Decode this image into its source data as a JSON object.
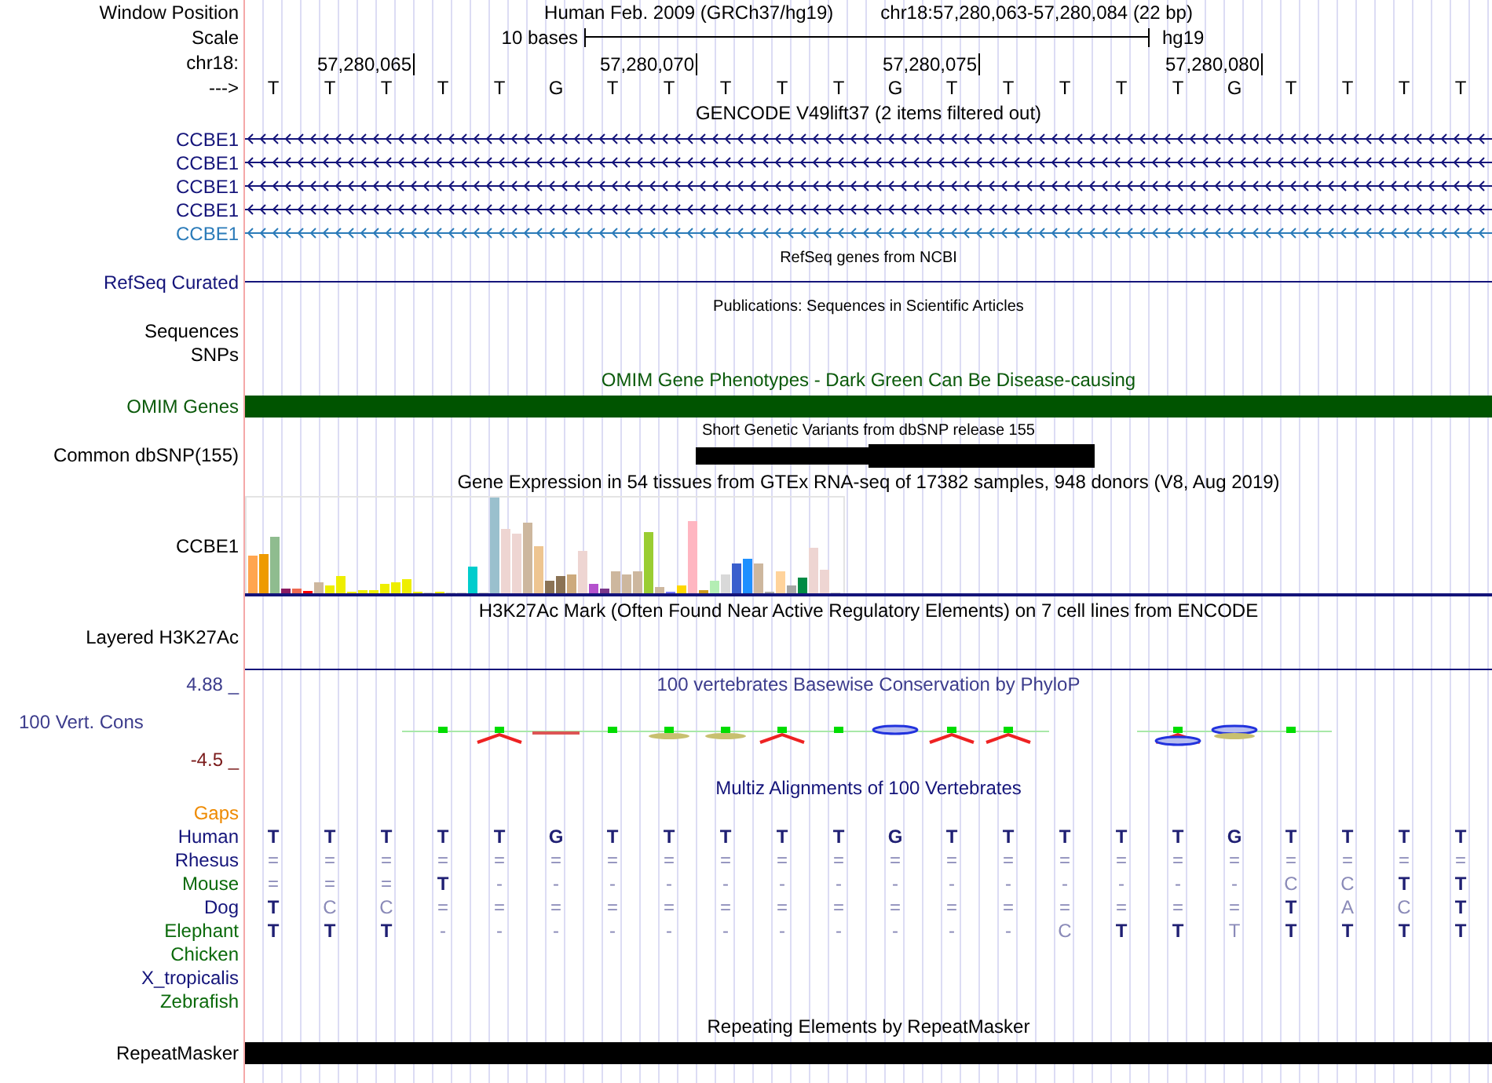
{
  "header": {
    "window_label": "Window Position",
    "assembly": "Human Feb. 2009 (GRCh37/hg19)",
    "position": "chr18:57,280,063-57,280,084 (22 bp)",
    "scale_label": "Scale",
    "scale_text": "10 bases",
    "scale_db": "hg19",
    "chrom_label": "chr18:",
    "ticks": [
      "57,280,065",
      "57,280,070",
      "57,280,075",
      "57,280,080"
    ],
    "strand_label": "--->",
    "bases": [
      "T",
      "T",
      "T",
      "T",
      "T",
      "G",
      "T",
      "T",
      "T",
      "T",
      "T",
      "G",
      "T",
      "T",
      "T",
      "T",
      "T",
      "G",
      "T",
      "T",
      "T",
      "T"
    ]
  },
  "tracks": [
    {
      "kind": "genes",
      "title": {
        "text": "GENCODE V49lift37 (2 items filtered out)",
        "color": "#000000"
      },
      "items": [
        {
          "label": "CCBE1",
          "color": "#14147a"
        },
        {
          "label": "CCBE1",
          "color": "#14147a"
        },
        {
          "label": "CCBE1",
          "color": "#14147a"
        },
        {
          "label": "CCBE1",
          "color": "#14147a"
        },
        {
          "label": "CCBE1",
          "color": "#2b7bb9"
        }
      ]
    },
    {
      "kind": "line",
      "title": {
        "text": "RefSeq genes from NCBI",
        "color": "#000000"
      },
      "label": {
        "text": "RefSeq Curated",
        "color": "#14147a"
      }
    },
    {
      "kind": "labels",
      "title": {
        "text": "Publications: Sequences in Scientific Articles",
        "color": "#000000"
      },
      "labels": [
        "Sequences",
        "SNPs"
      ]
    },
    {
      "kind": "bar",
      "title": {
        "text": "OMIM Gene Phenotypes - Dark Green Can Be Disease-causing",
        "color": "#0b5a0b"
      },
      "label": {
        "text": "OMIM Genes",
        "color": "#0b5a0b"
      },
      "bar": {
        "color": "#005400"
      }
    },
    {
      "kind": "snp",
      "title": {
        "text": "Short Genetic Variants from dbSNP release 155",
        "color": "#000000"
      },
      "label": {
        "text": "Common dbSNP(155)",
        "color": "#000000"
      }
    },
    {
      "kind": "expression",
      "title": {
        "text": "Gene Expression in 54 tissues from GTEx RNA-seq of 17382 samples, 948 donors (V8, Aug 2019)",
        "color": "#000000"
      },
      "label": {
        "text": "CCBE1",
        "color": "#000000"
      }
    },
    {
      "kind": "blank",
      "title": {
        "text": "H3K27Ac Mark (Often Found Near Active Regulatory Elements) on 7 cell lines from ENCODE",
        "color": "#000000"
      },
      "label": {
        "text": "Layered H3K27Ac",
        "color": "#000000"
      }
    },
    {
      "kind": "wiggle",
      "title": {
        "text": "100 vertebrates Basewise Conservation by PhyloP",
        "color": "#3c3c8c"
      },
      "label": {
        "text": "100 Vert. Cons",
        "color": "#3c3c8c"
      },
      "max": {
        "text": "4.88 _",
        "color": "#3c3c8c"
      },
      "min": {
        "text": "-4.5 _",
        "color": "#7a1a1a"
      }
    },
    {
      "kind": "alignment",
      "title": {
        "text": "Multiz Alignments of 100 Vertebrates",
        "color": "#14147a"
      },
      "gaps": {
        "text": "Gaps",
        "color": "#ee8a00"
      },
      "rows": [
        {
          "species": "Human",
          "color": "#14147a",
          "cells": [
            {
              "base": "T",
              "faint": false
            },
            {
              "base": "T",
              "faint": false
            },
            {
              "base": "T",
              "faint": false
            },
            {
              "base": "T",
              "faint": false
            },
            {
              "base": "T",
              "faint": false
            },
            {
              "base": "G",
              "faint": false
            },
            {
              "base": "T",
              "faint": false
            },
            {
              "base": "T",
              "faint": false
            },
            {
              "base": "T",
              "faint": false
            },
            {
              "base": "T",
              "faint": false
            },
            {
              "base": "T",
              "faint": false
            },
            {
              "base": "G",
              "faint": false
            },
            {
              "base": "T",
              "faint": false
            },
            {
              "base": "T",
              "faint": false
            },
            {
              "base": "T",
              "faint": false
            },
            {
              "base": "T",
              "faint": false
            },
            {
              "base": "T",
              "faint": false
            },
            {
              "base": "G",
              "faint": false
            },
            {
              "base": "T",
              "faint": false
            },
            {
              "base": "T",
              "faint": false
            },
            {
              "base": "T",
              "faint": false
            },
            {
              "base": "T",
              "faint": false
            }
          ]
        },
        {
          "species": "Rhesus",
          "color": "#14147a",
          "cells": [
            {
              "base": "=",
              "faint": true
            },
            {
              "base": "=",
              "faint": true
            },
            {
              "base": "=",
              "faint": true
            },
            {
              "base": "=",
              "faint": true
            },
            {
              "base": "=",
              "faint": true
            },
            {
              "base": "=",
              "faint": true
            },
            {
              "base": "=",
              "faint": true
            },
            {
              "base": "=",
              "faint": true
            },
            {
              "base": "=",
              "faint": true
            },
            {
              "base": "=",
              "faint": true
            },
            {
              "base": "=",
              "faint": true
            },
            {
              "base": "=",
              "faint": true
            },
            {
              "base": "=",
              "faint": true
            },
            {
              "base": "=",
              "faint": true
            },
            {
              "base": "=",
              "faint": true
            },
            {
              "base": "=",
              "faint": true
            },
            {
              "base": "=",
              "faint": true
            },
            {
              "base": "=",
              "faint": true
            },
            {
              "base": "=",
              "faint": true
            },
            {
              "base": "=",
              "faint": true
            },
            {
              "base": "=",
              "faint": true
            },
            {
              "base": "=",
              "faint": true
            }
          ]
        },
        {
          "species": "Mouse",
          "color": "#0b6a0b",
          "cells": [
            {
              "base": "=",
              "faint": true
            },
            {
              "base": "=",
              "faint": true
            },
            {
              "base": "=",
              "faint": true
            },
            {
              "base": "T",
              "faint": false
            },
            {
              "base": "-",
              "faint": true
            },
            {
              "base": "-",
              "faint": true
            },
            {
              "base": "-",
              "faint": true
            },
            {
              "base": "-",
              "faint": true
            },
            {
              "base": "-",
              "faint": true
            },
            {
              "base": "-",
              "faint": true
            },
            {
              "base": "-",
              "faint": true
            },
            {
              "base": "-",
              "faint": true
            },
            {
              "base": "-",
              "faint": true
            },
            {
              "base": "-",
              "faint": true
            },
            {
              "base": "-",
              "faint": true
            },
            {
              "base": "-",
              "faint": true
            },
            {
              "base": "-",
              "faint": true
            },
            {
              "base": "-",
              "faint": true
            },
            {
              "base": "C",
              "faint": true
            },
            {
              "base": "C",
              "faint": true
            },
            {
              "base": "T",
              "faint": false
            },
            {
              "base": "T",
              "faint": false
            }
          ]
        },
        {
          "species": "Dog",
          "color": "#14147a",
          "cells": [
            {
              "base": "T",
              "faint": false
            },
            {
              "base": "C",
              "faint": true
            },
            {
              "base": "C",
              "faint": true
            },
            {
              "base": "=",
              "faint": true
            },
            {
              "base": "=",
              "faint": true
            },
            {
              "base": "=",
              "faint": true
            },
            {
              "base": "=",
              "faint": true
            },
            {
              "base": "=",
              "faint": true
            },
            {
              "base": "=",
              "faint": true
            },
            {
              "base": "=",
              "faint": true
            },
            {
              "base": "=",
              "faint": true
            },
            {
              "base": "=",
              "faint": true
            },
            {
              "base": "=",
              "faint": true
            },
            {
              "base": "=",
              "faint": true
            },
            {
              "base": "=",
              "faint": true
            },
            {
              "base": "=",
              "faint": true
            },
            {
              "base": "=",
              "faint": true
            },
            {
              "base": "=",
              "faint": true
            },
            {
              "base": "T",
              "faint": false
            },
            {
              "base": "A",
              "faint": true
            },
            {
              "base": "C",
              "faint": true
            },
            {
              "base": "T",
              "faint": false
            }
          ]
        },
        {
          "species": "Elephant",
          "color": "#0b6a0b",
          "cells": [
            {
              "base": "T",
              "faint": false
            },
            {
              "base": "T",
              "faint": false
            },
            {
              "base": "T",
              "faint": false
            },
            {
              "base": "-",
              "faint": true
            },
            {
              "base": "-",
              "faint": true
            },
            {
              "base": "-",
              "faint": true
            },
            {
              "base": "-",
              "faint": true
            },
            {
              "base": "-",
              "faint": true
            },
            {
              "base": "-",
              "faint": true
            },
            {
              "base": "-",
              "faint": true
            },
            {
              "base": "-",
              "faint": true
            },
            {
              "base": "-",
              "faint": true
            },
            {
              "base": "-",
              "faint": true
            },
            {
              "base": "-",
              "faint": true
            },
            {
              "base": "C",
              "faint": true
            },
            {
              "base": "T",
              "faint": false
            },
            {
              "base": "T",
              "faint": false
            },
            {
              "base": "T",
              "faint": true
            },
            {
              "base": "T",
              "faint": false
            },
            {
              "base": "T",
              "faint": false
            },
            {
              "base": "T",
              "faint": false
            },
            {
              "base": "T",
              "faint": false
            }
          ]
        },
        {
          "species": "Chicken",
          "color": "#0b6a0b"
        },
        {
          "species": "X_tropicalis",
          "color": "#14147a"
        },
        {
          "species": "Zebrafish",
          "color": "#0b6a0b"
        }
      ]
    },
    {
      "kind": "bar",
      "title": {
        "text": "Repeating Elements by RepeatMasker",
        "color": "#000000"
      },
      "label": {
        "text": "RepeatMasker",
        "color": "#000000"
      },
      "bar": {
        "color": "#000000"
      }
    }
  ]
}
